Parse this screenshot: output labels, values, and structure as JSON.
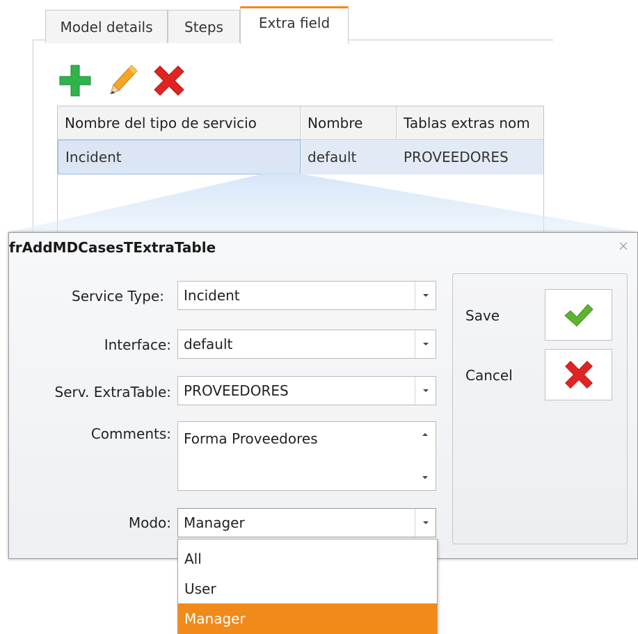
{
  "tabs": [
    {
      "label": "Model details"
    },
    {
      "label": "Steps"
    },
    {
      "label": "Extra field"
    }
  ],
  "toolbar": {
    "add_icon": "plus-icon",
    "edit_icon": "pencil-icon",
    "delete_icon": "delete-x-icon"
  },
  "grid": {
    "columns": [
      "Nombre del tipo de servicio",
      "Nombre",
      "Tablas extras nom"
    ],
    "rows": [
      [
        "Incident",
        "default",
        "PROVEEDORES"
      ]
    ]
  },
  "dialog": {
    "title": "frAddMDCasesTExtraTable",
    "close_icon": "close-icon",
    "fields": {
      "service_type": {
        "label": "Service Type:",
        "value": "Incident"
      },
      "interface": {
        "label": "Interface:",
        "value": "default"
      },
      "serv_extra_table": {
        "label": "Serv. ExtraTable:",
        "value": "PROVEEDORES"
      },
      "comments": {
        "label": "Comments:",
        "value": "Forma Proveedores"
      },
      "modo": {
        "label": "Modo:",
        "value": "Manager"
      }
    },
    "actions": {
      "save_label": "Save",
      "cancel_label": "Cancel"
    },
    "modo_options": [
      "All",
      "User",
      "Manager"
    ],
    "modo_selected": "Manager"
  },
  "colors": {
    "accent": "#f28a1a",
    "add_green": "#2fb34a",
    "delete_red": "#e02424",
    "save_green": "#5cb531",
    "row_selected": "#e2eaf5"
  }
}
